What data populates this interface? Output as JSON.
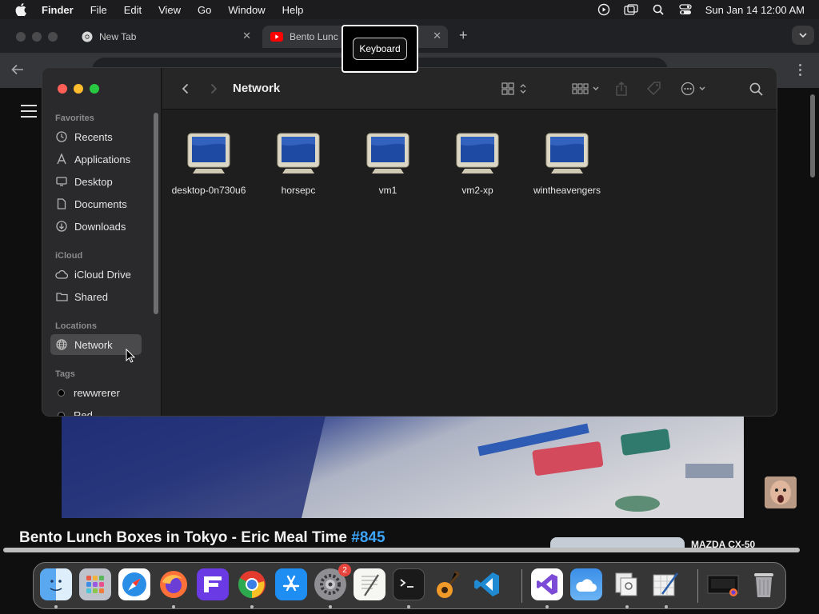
{
  "menubar": {
    "app": "Finder",
    "items": [
      "File",
      "Edit",
      "View",
      "Go",
      "Window",
      "Help"
    ],
    "clock": "Sun Jan 14  12:00 AM"
  },
  "browser": {
    "tabs": [
      {
        "label": "New Tab",
        "icon": "chrome-icon"
      },
      {
        "label": "Bento Lunc",
        "icon": "youtube-icon"
      }
    ],
    "tooltip": "Keyboard"
  },
  "finder": {
    "title": "Network",
    "sidebar": {
      "favorites_title": "Favorites",
      "favorites": [
        {
          "label": "Recents",
          "icon": "clock-icon"
        },
        {
          "label": "Applications",
          "icon": "applications-icon"
        },
        {
          "label": "Desktop",
          "icon": "desktop-icon"
        },
        {
          "label": "Documents",
          "icon": "document-icon"
        },
        {
          "label": "Downloads",
          "icon": "download-icon"
        }
      ],
      "icloud_title": "iCloud",
      "icloud": [
        {
          "label": "iCloud Drive",
          "icon": "cloud-icon"
        },
        {
          "label": "Shared",
          "icon": "shared-folder-icon"
        }
      ],
      "locations_title": "Locations",
      "locations": [
        {
          "label": "Network",
          "icon": "globe-icon",
          "selected": true
        }
      ],
      "tags_title": "Tags",
      "tags": [
        {
          "label": "rewwrerer",
          "color": "#000000"
        },
        {
          "label": "Red",
          "color": "#000000"
        }
      ]
    },
    "computers": [
      "desktop-0n730u6",
      "horsepc",
      "vm1",
      "vm2-xp",
      "wintheavengers"
    ]
  },
  "video": {
    "title": "Bento Lunch Boxes in Tokyo - Eric Meal Time",
    "hashtag": "#845",
    "sidebar_text": "MAZDA CX-50"
  },
  "dock": {
    "apps": [
      "finder",
      "launchpad",
      "safari",
      "firefox",
      "fleet",
      "chrome",
      "app-store",
      "system-settings",
      "textedit",
      "terminal",
      "garageband",
      "vscode",
      "visual-studio",
      "weather",
      "preview",
      "script-editor",
      "screenshot",
      "trash"
    ],
    "settings_badge": "2"
  },
  "colors": {
    "accent_blue": "#3ea6ff",
    "close_red": "#ff5f57",
    "minimize_yellow": "#febc2e",
    "zoom_green": "#28c840"
  }
}
